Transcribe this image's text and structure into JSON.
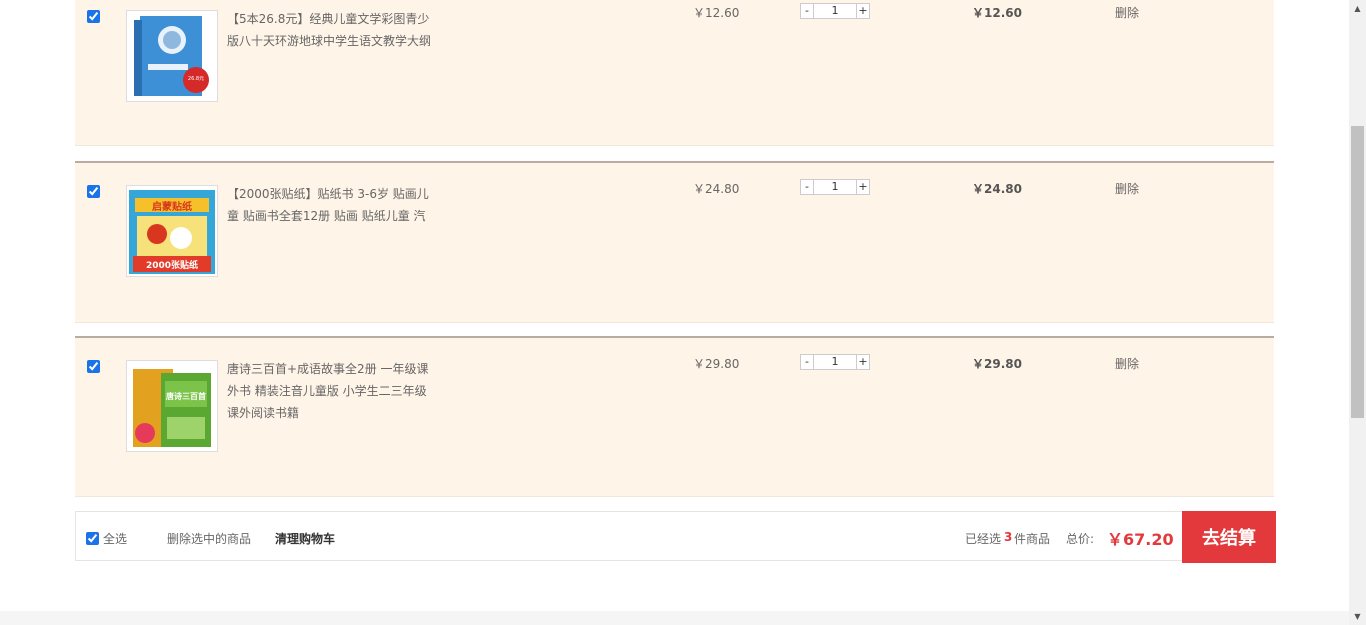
{
  "items": [
    {
      "title": "【5本26.8元】经典儿童文学彩图青少版八十天环游地球中学生语文教学大纲",
      "price": "￥12.60",
      "qty_minus": "-",
      "qty_value": "1",
      "qty_plus": "+",
      "subtotal": "￥12.60",
      "delete_label": "删除",
      "cover_badge": "26.8元"
    },
    {
      "title": "【2000张贴纸】贴纸书 3-6岁 贴画儿童 贴画书全套12册 贴画 贴纸儿童 汽",
      "price": "￥24.80",
      "qty_minus": "-",
      "qty_value": "1",
      "qty_plus": "+",
      "subtotal": "￥24.80",
      "delete_label": "删除",
      "cover_text": "启蒙贴纸",
      "cover_badge": "2000张贴纸"
    },
    {
      "title": "唐诗三百首+成语故事全2册 一年级课外书 精装注音儿童版 小学生二三年级课外阅读书籍",
      "price": "￥29.80",
      "qty_minus": "-",
      "qty_value": "1",
      "qty_plus": "+",
      "subtotal": "￥29.80",
      "delete_label": "删除",
      "cover_text": "唐诗三百首"
    }
  ],
  "footer": {
    "select_all_label": "全选",
    "delete_selected_label": "删除选中的商品",
    "clear_cart_label": "清理购物车",
    "selected_prefix": "已经选",
    "selected_count": "3",
    "selected_suffix": "件商品",
    "total_label": "总价:",
    "total_value": "￥67.20",
    "checkout_label": "去结算"
  },
  "colors": {
    "accent_red": "#e4393c",
    "row_background": "#fff4e8"
  }
}
